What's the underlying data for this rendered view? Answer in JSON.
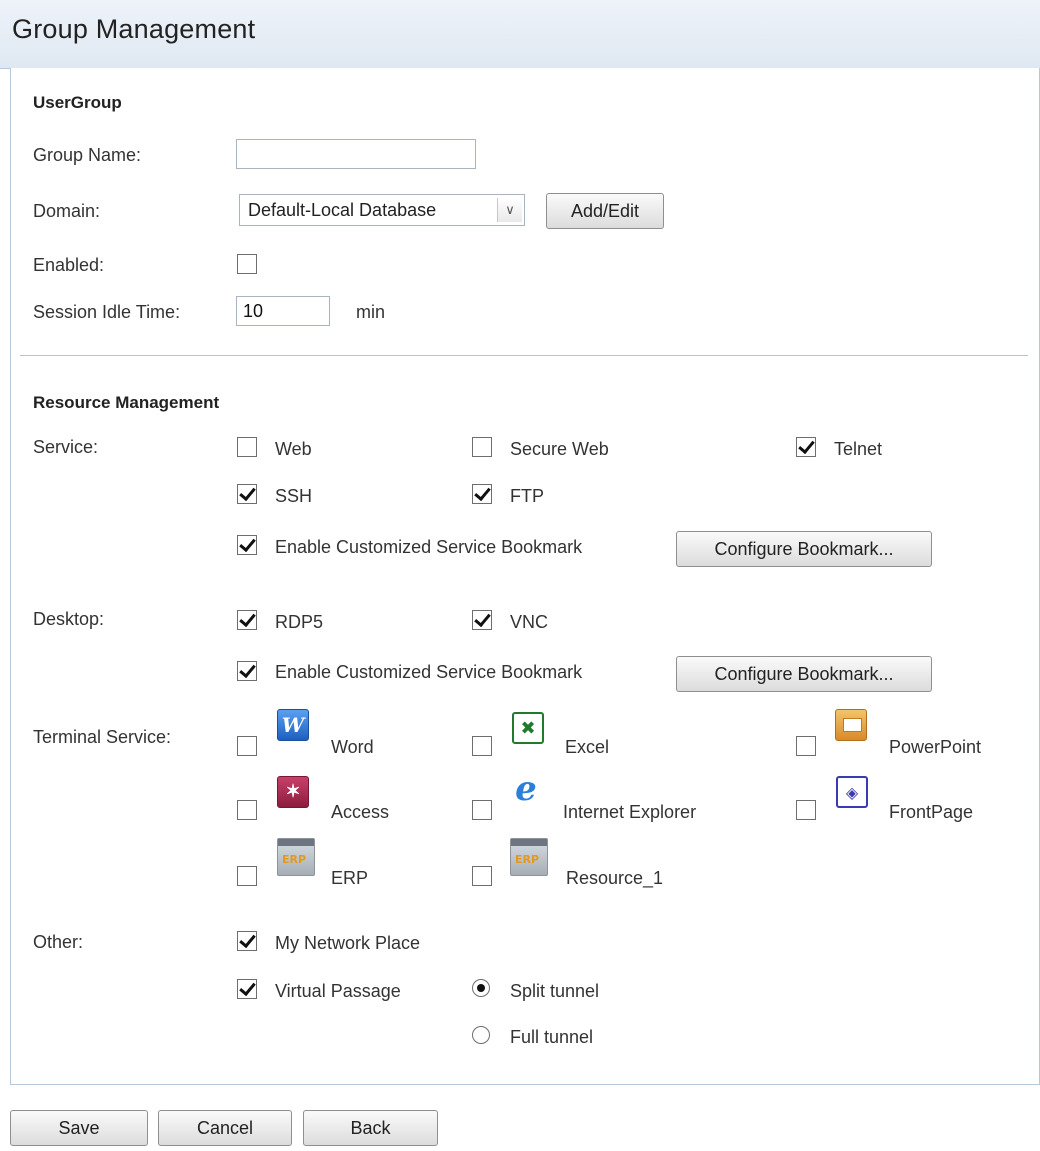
{
  "page_title": "Group Management",
  "usergroup": {
    "section_title": "UserGroup",
    "group_name_label": "Group Name:",
    "group_name_value": "",
    "domain_label": "Domain:",
    "domain_value": "Default-Local Database",
    "add_edit_label": "Add/Edit",
    "enabled_label": "Enabled:",
    "enabled_checked": false,
    "idle_label": "Session Idle Time:",
    "idle_value": "10",
    "idle_unit": "min"
  },
  "resource": {
    "section_title": "Resource Management",
    "service_label": "Service:",
    "service_items": [
      {
        "label": "Web",
        "checked": false
      },
      {
        "label": "Secure Web",
        "checked": false
      },
      {
        "label": "Telnet",
        "checked": true
      },
      {
        "label": "SSH",
        "checked": true
      },
      {
        "label": "FTP",
        "checked": true
      }
    ],
    "service_bookmark_label": "Enable Customized Service Bookmark",
    "service_bookmark_checked": true,
    "configure_bookmark_label": "Configure Bookmark...",
    "desktop_label": "Desktop:",
    "desktop_items": [
      {
        "label": "RDP5",
        "checked": true
      },
      {
        "label": "VNC",
        "checked": true
      }
    ],
    "desktop_bookmark_label": "Enable Customized Service Bookmark",
    "desktop_bookmark_checked": true,
    "terminal_label": "Terminal Service:",
    "terminal_items": [
      {
        "label": "Word",
        "icon": "word-icon",
        "checked": false
      },
      {
        "label": "Excel",
        "icon": "excel-icon",
        "checked": false
      },
      {
        "label": "PowerPoint",
        "icon": "powerpoint-icon",
        "checked": false
      },
      {
        "label": "Access",
        "icon": "access-icon",
        "checked": false
      },
      {
        "label": "Internet Explorer",
        "icon": "internet-explorer-icon",
        "checked": false
      },
      {
        "label": "FrontPage",
        "icon": "frontpage-icon",
        "checked": false
      },
      {
        "label": "ERP",
        "icon": "erp-icon",
        "checked": false
      },
      {
        "label": "Resource_1",
        "icon": "erp-icon",
        "checked": false
      }
    ],
    "other_label": "Other:",
    "network_place_label": "My Network Place",
    "network_place_checked": true,
    "virtual_passage_label": "Virtual Passage",
    "virtual_passage_checked": true,
    "split_tunnel_label": "Split tunnel",
    "full_tunnel_label": "Full tunnel",
    "tunnel_mode": "Split tunnel"
  },
  "footer": {
    "save_label": "Save",
    "cancel_label": "Cancel",
    "back_label": "Back"
  }
}
